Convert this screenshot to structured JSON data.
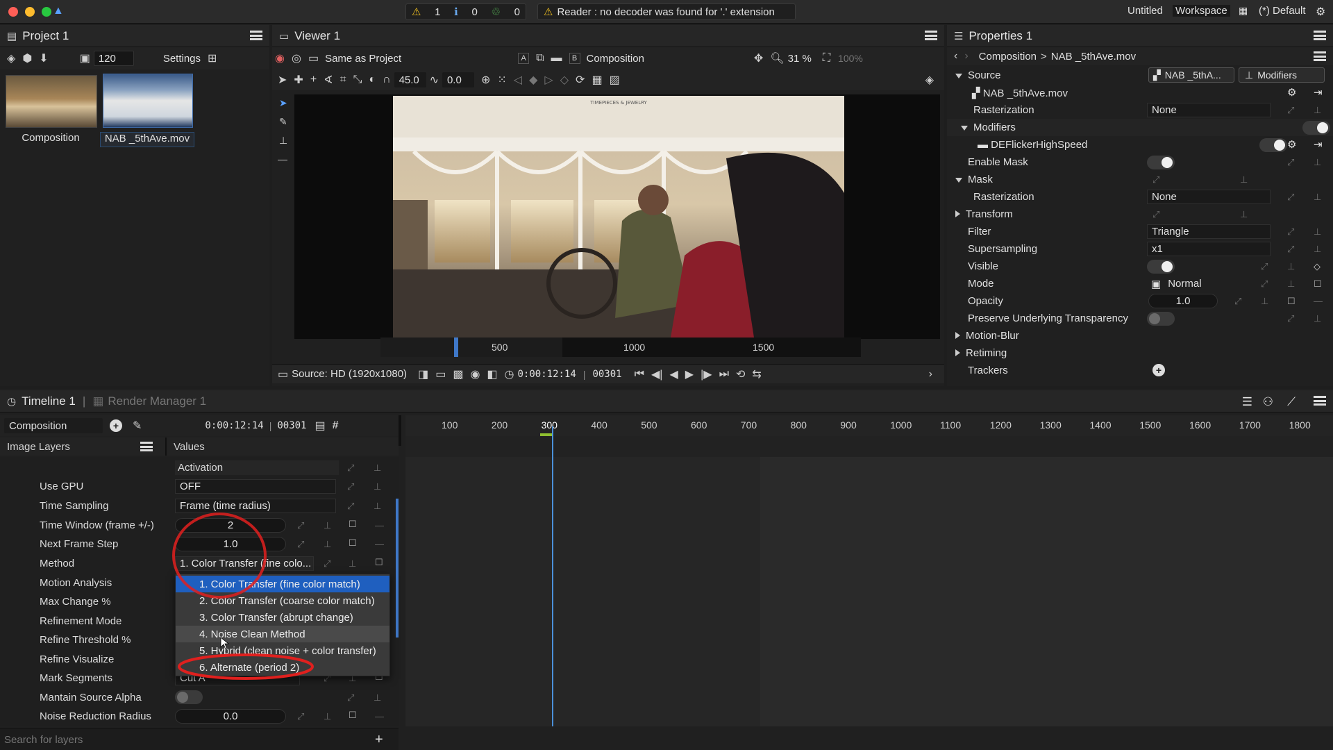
{
  "topbar": {
    "warnings": "1",
    "infos": "0",
    "tasks": "0",
    "message": "Reader : no decoder was found for '.' extension",
    "project_name": "Untitled",
    "workspace_label": "Workspace",
    "layout_label": "(*) Default"
  },
  "project": {
    "title": "Project 1",
    "thumb_size": "120",
    "settings_label": "Settings",
    "items": [
      {
        "label": "Composition"
      },
      {
        "label": "NAB _5thAve.mov"
      }
    ]
  },
  "viewer": {
    "title": "Viewer 1",
    "format": "Same as Project",
    "source_label": "Composition",
    "zoom": "31 %",
    "zoom_max": "100%",
    "angle": "45.0",
    "offset": "0.0",
    "ruler": [
      "500",
      "1000",
      "1500"
    ],
    "source": "Source: HD (1920x1080)",
    "timecode": "0:00:12:14",
    "frame": "00301",
    "signage": "TIMEPIECES & JEWELRY"
  },
  "properties": {
    "title": "Properties 1",
    "breadcrumb": [
      "Composition",
      ">",
      "NAB _5thAve.mov"
    ],
    "source_tab": "NAB _5thA...",
    "modifiers_tab": "Modifiers",
    "rows": {
      "source": "Source",
      "source_file": "NAB _5thAve.mov",
      "rasterization": "Rasterization",
      "rasterization_value": "None",
      "modifiers": "Modifiers",
      "deflicker": "DEFlickerHighSpeed",
      "enable_mask": "Enable Mask",
      "mask": "Mask",
      "mask_rasterization": "Rasterization",
      "mask_rasterization_value": "None",
      "transform": "Transform",
      "filter": "Filter",
      "filter_value": "Triangle",
      "supersampling": "Supersampling",
      "supersampling_value": "x1",
      "visible": "Visible",
      "mode": "Mode",
      "mode_value": "Normal",
      "opacity": "Opacity",
      "opacity_value": "1.0",
      "preserve": "Preserve Underlying Transparency",
      "motion_blur": "Motion-Blur",
      "retiming": "Retiming",
      "trackers": "Trackers"
    }
  },
  "timeline": {
    "title": "Timeline 1",
    "render_manager": "Render Manager 1",
    "composition": "Composition",
    "timecode": "0:00:12:14",
    "frame": "00301",
    "layers_header": "Image Layers",
    "values_header": "Values",
    "ruler": [
      "100",
      "200",
      "300",
      "400",
      "500",
      "600",
      "700",
      "800",
      "900",
      "1000",
      "1100",
      "1200",
      "1300",
      "1400",
      "1500",
      "1600",
      "1700",
      "1800"
    ],
    "params": {
      "activation": "Activation",
      "use_gpu": "Use GPU",
      "use_gpu_value": "OFF",
      "time_sampling": "Time Sampling",
      "time_sampling_value": "Frame (time radius)",
      "time_window": "Time Window (frame +/-)",
      "time_window_value": "2",
      "next_frame_step": "Next Frame Step",
      "next_frame_step_value": "1.0",
      "method": "Method",
      "method_value": "1. Color Transfer (fine colo...",
      "motion_analysis": "Motion Analysis",
      "max_change": "Max Change %",
      "refinement_mode": "Refinement Mode",
      "refine_threshold": "Refine Threshold %",
      "refine_visualize": "Refine Visualize",
      "mark_segments": "Mark Segments",
      "mark_segments_value": "Cut A",
      "maintain_alpha": "Mantain Source Alpha",
      "noise_radius": "Noise Reduction Radius",
      "noise_radius_value": "0.0"
    },
    "dropdown": [
      "1. Color Transfer (fine color match)",
      "2. Color Transfer (coarse color match)",
      "3. Color Transfer (abrupt change)",
      "4. Noise Clean Method",
      "5. Hybrid (clean noise + color transfer)",
      "6. Alternate (period 2)"
    ],
    "search_placeholder": "Search for layers"
  },
  "colors": {
    "accent": "#1f5fbf",
    "annotation": "#e0201e",
    "playhead": "#4a90d9"
  }
}
